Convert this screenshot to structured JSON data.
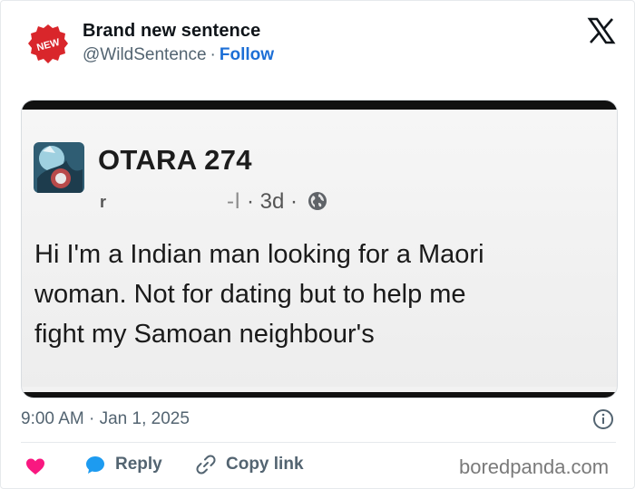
{
  "tweet": {
    "author_name": "Brand new sentence",
    "handle": "@WildSentence",
    "separator": "·",
    "follow_label": "Follow",
    "avatar_badge_text": "NEW",
    "timestamp": "9:00 AM · Jan 1, 2025"
  },
  "embedded_post": {
    "page_name": "OTARA 274",
    "stray_char": "r",
    "meta_blurred": "-l",
    "meta_time": "· 3d ·",
    "lines": [
      "Hi I'm a Indian man looking for a Maori",
      "woman. Not for dating but to help me",
      "fight my Samoan neighbour's"
    ]
  },
  "actions": {
    "reply_label": "Reply",
    "copy_link_label": "Copy link"
  },
  "watermark": "boredpanda.com",
  "colors": {
    "follow": "#1d6fd6",
    "heart": "#f91880",
    "reply_bubble": "#1d9bf0",
    "badge_red": "#d9262b",
    "muted": "#536471"
  },
  "icons": {
    "brand": "x-logo-icon",
    "globe": "globe-icon",
    "info": "info-icon",
    "heart": "heart-icon",
    "reply": "reply-bubble-icon",
    "link": "link-icon"
  }
}
